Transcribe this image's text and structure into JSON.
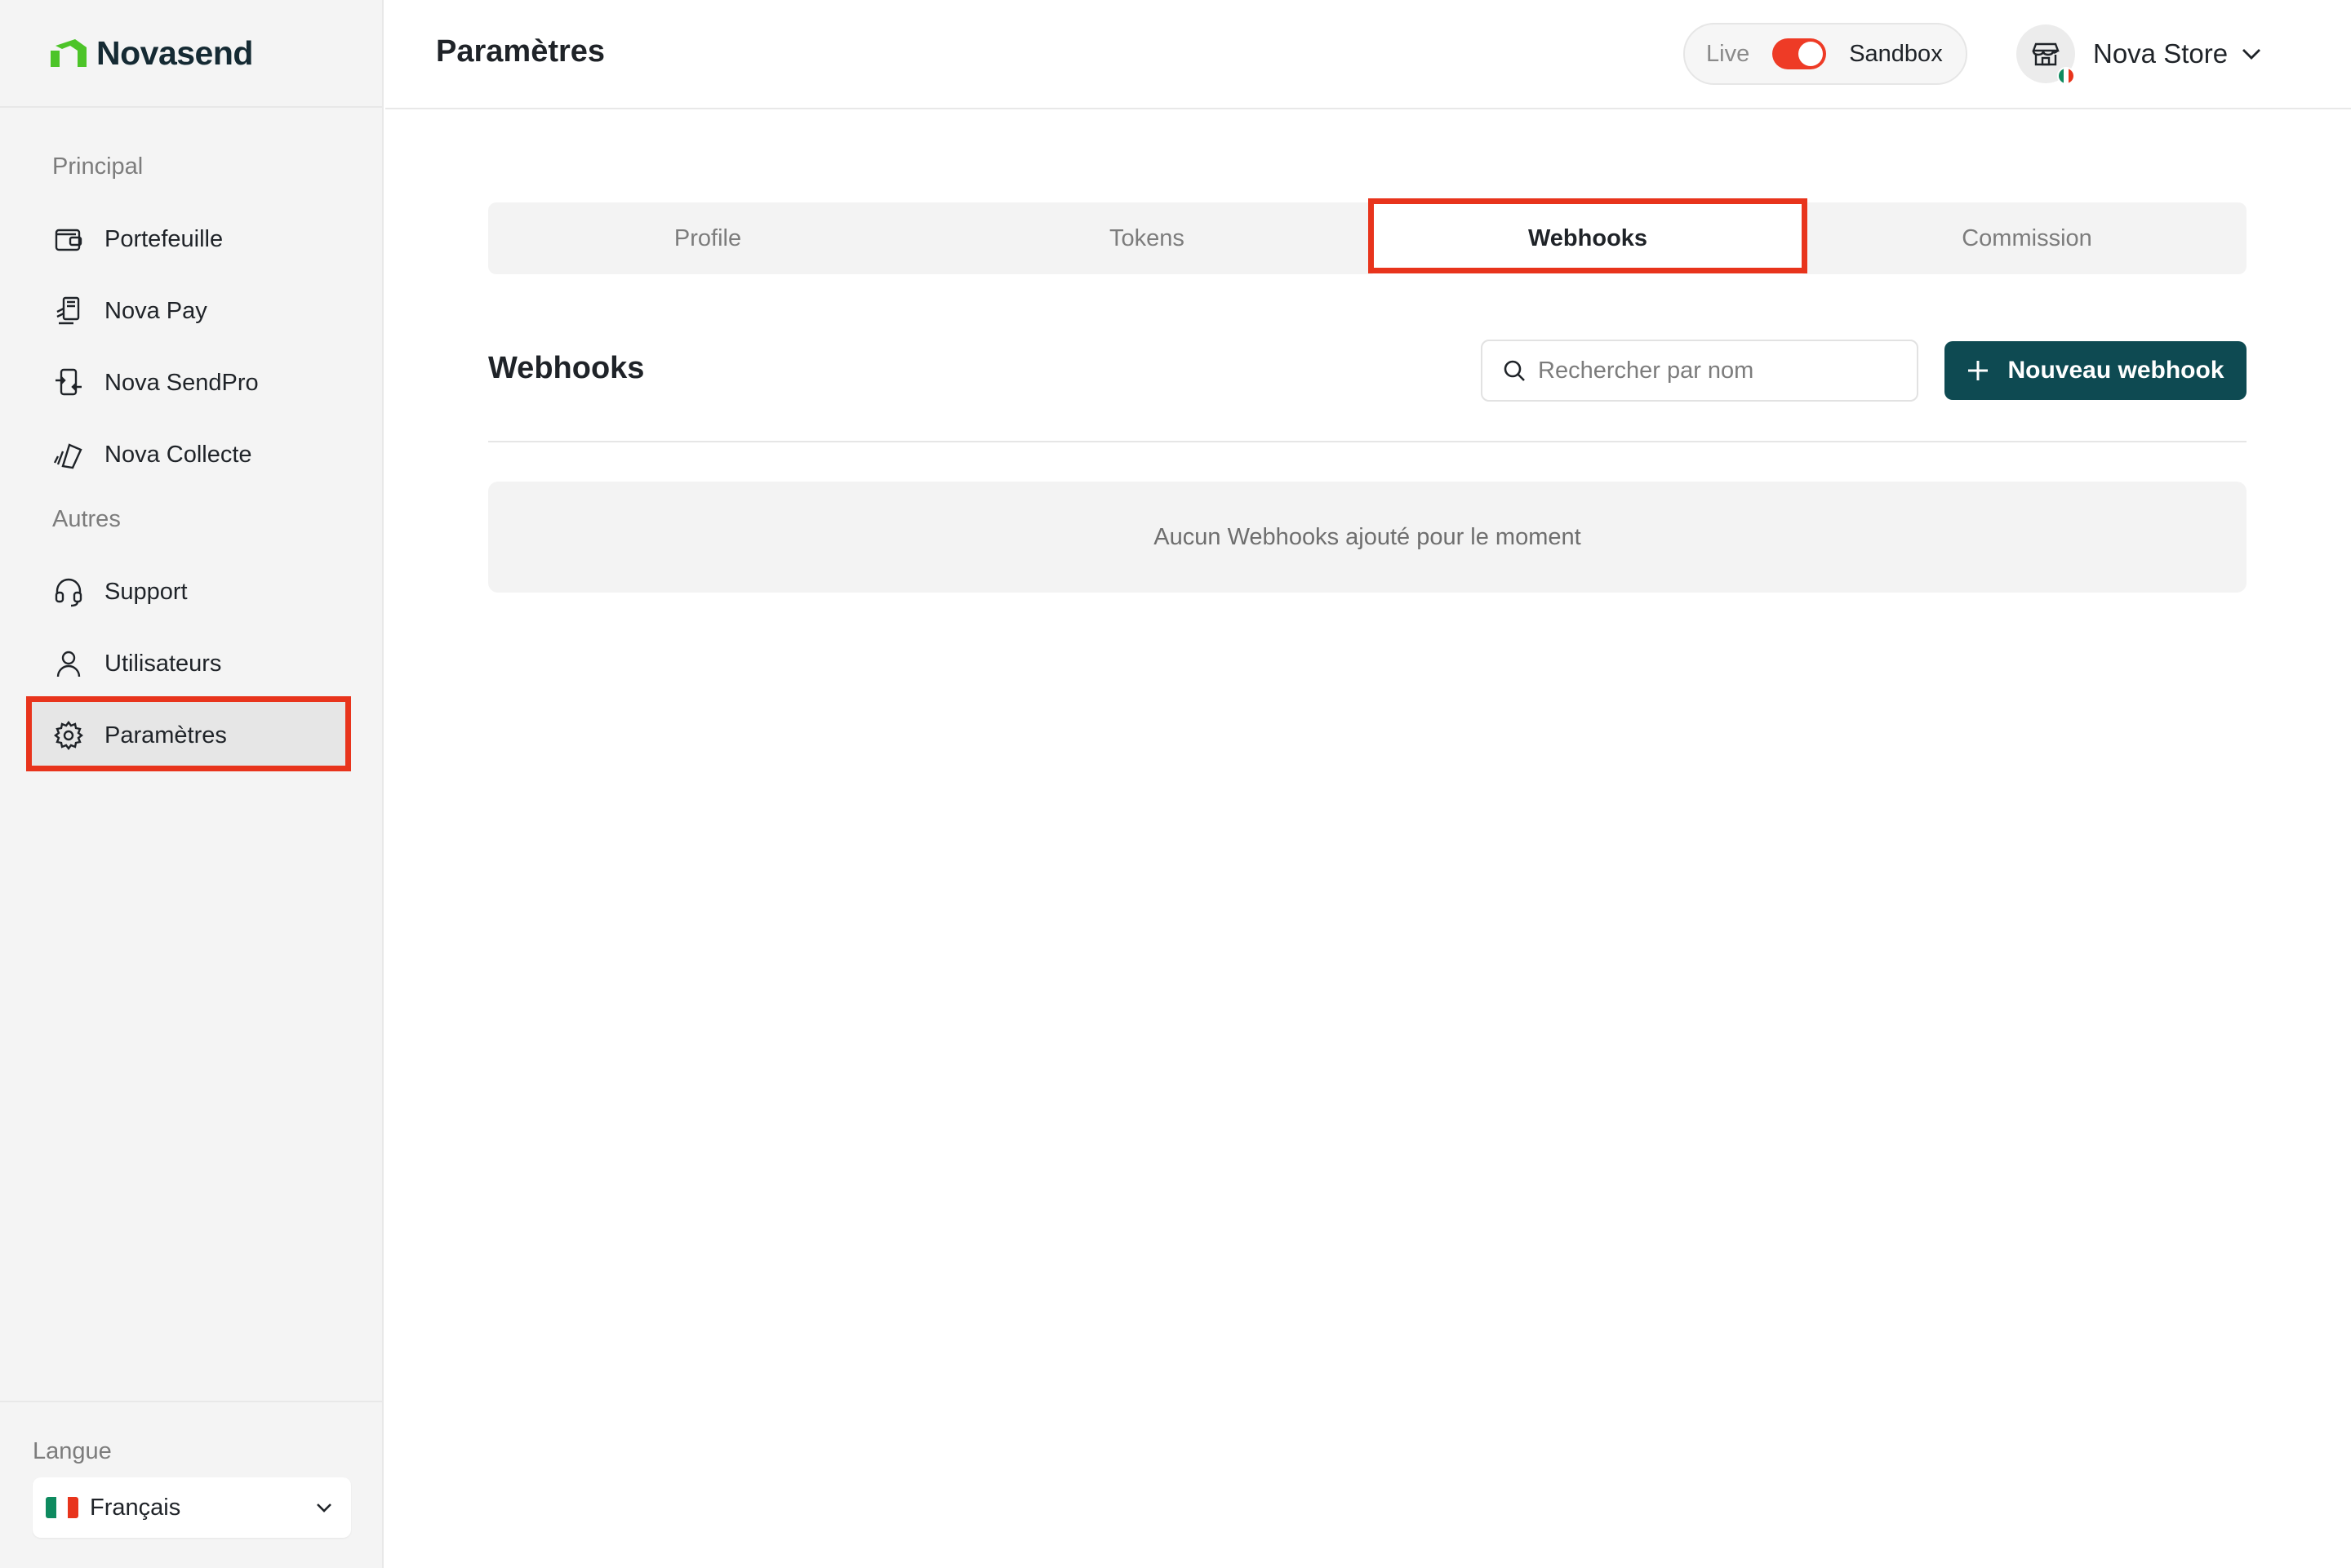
{
  "app": {
    "name": "Novasend"
  },
  "sidebar": {
    "sections": [
      {
        "label": "Principal"
      },
      {
        "label": "Autres"
      }
    ],
    "items": [
      {
        "label": "Portefeuille",
        "icon": "wallet-icon"
      },
      {
        "label": "Nova Pay",
        "icon": "pos-terminal-icon"
      },
      {
        "label": "Nova SendPro",
        "icon": "phone-transfer-icon"
      },
      {
        "label": "Nova Collecte",
        "icon": "cards-icon"
      },
      {
        "label": "Support",
        "icon": "headset-icon"
      },
      {
        "label": "Utilisateurs",
        "icon": "user-icon"
      },
      {
        "label": "Paramètres",
        "icon": "gear-icon",
        "active": true
      }
    ],
    "language": {
      "label": "Langue",
      "selected": "Français"
    }
  },
  "header": {
    "title": "Paramètres",
    "env": {
      "live": "Live",
      "sandbox": "Sandbox",
      "sandbox_on": true
    },
    "store": {
      "name": "Nova Store"
    }
  },
  "tabs": [
    {
      "label": "Profile"
    },
    {
      "label": "Tokens"
    },
    {
      "label": "Webhooks",
      "active": true
    },
    {
      "label": "Commission"
    }
  ],
  "webhooks": {
    "title": "Webhooks",
    "search_placeholder": "Rechercher par nom",
    "new_button": "Nouveau webhook",
    "empty_message": "Aucun Webhooks ajouté pour le moment"
  },
  "colors": {
    "brand_green": "#4cc428",
    "primary": "#0e4a52",
    "highlight": "#e8341c",
    "toggle": "#ee3b26"
  }
}
